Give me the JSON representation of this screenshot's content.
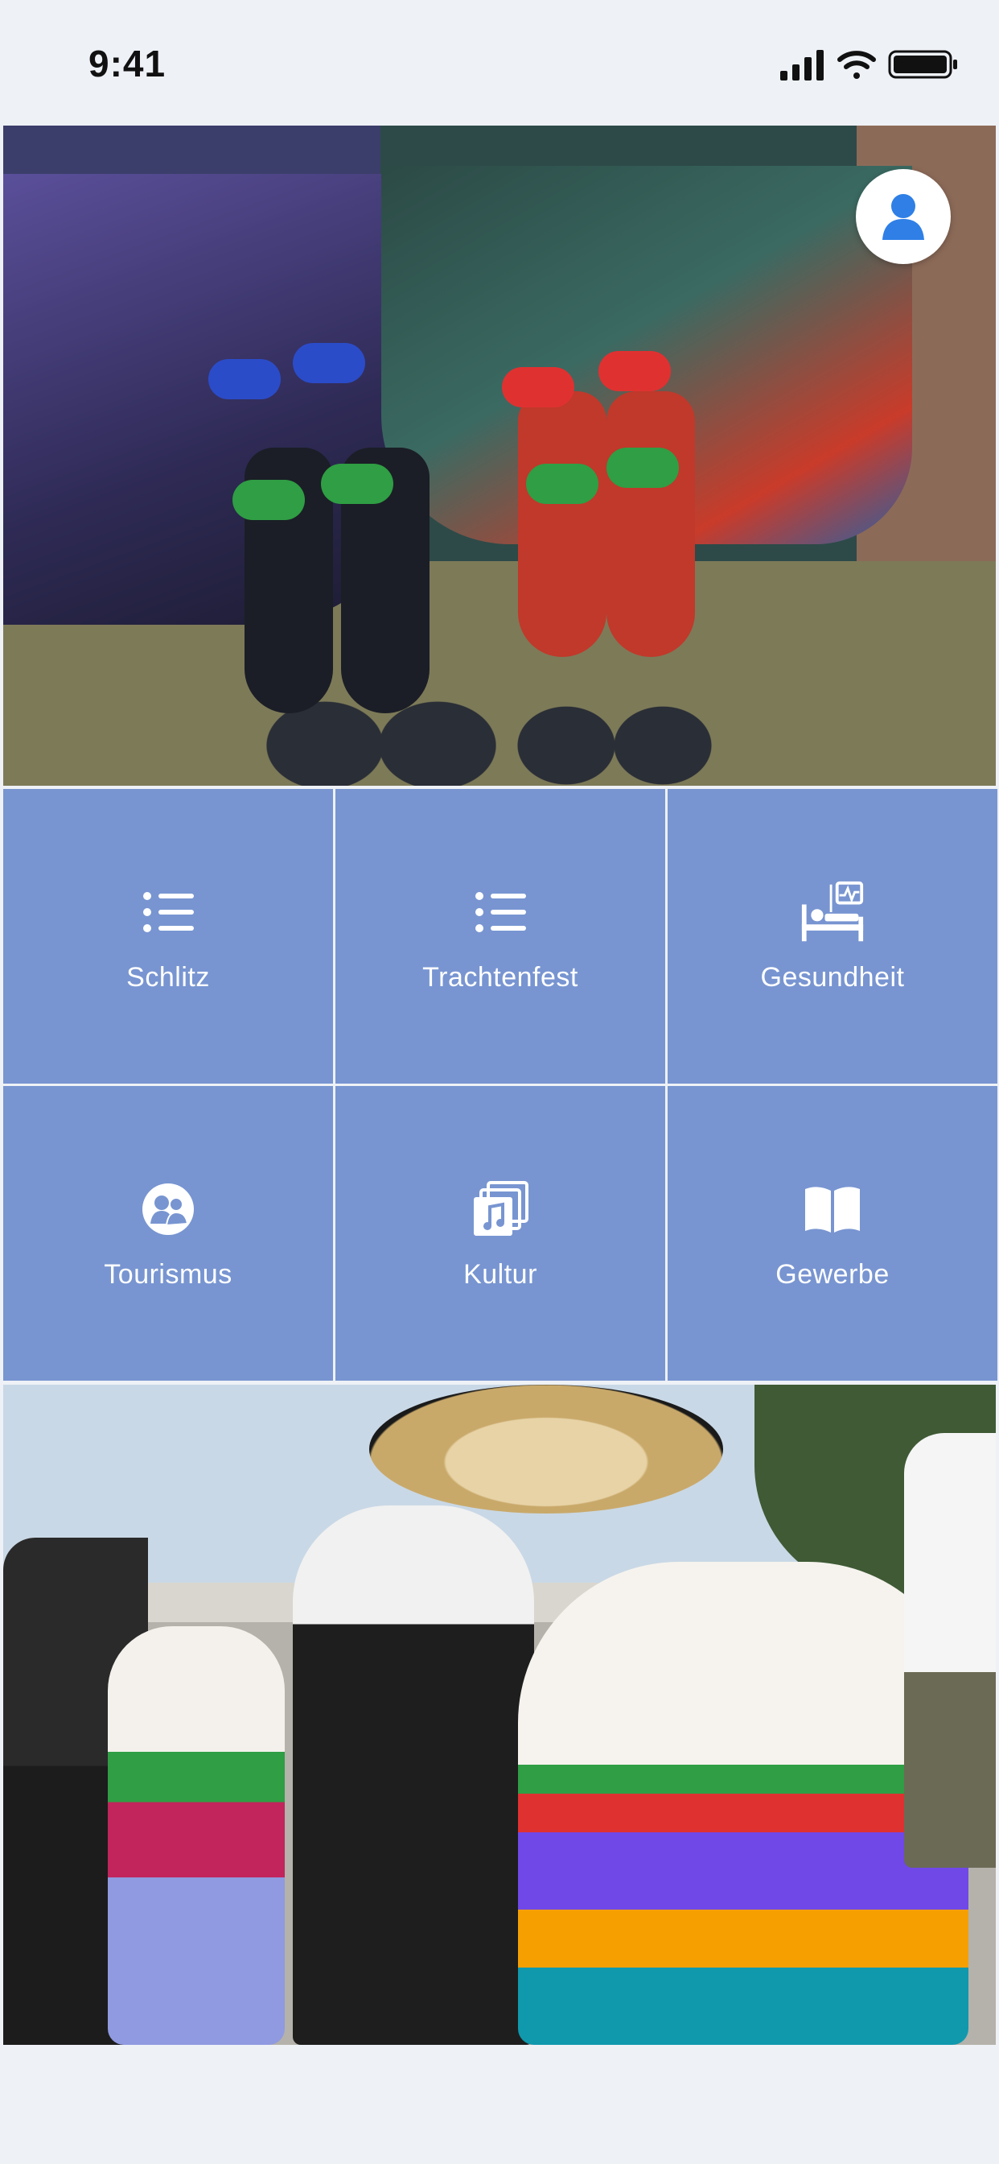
{
  "status_bar": {
    "time": "9:41",
    "icons": [
      "cellular-signal-icon",
      "wifi-icon",
      "battery-icon"
    ]
  },
  "header": {
    "profile_icon": "user-icon"
  },
  "tiles": [
    {
      "label": "Schlitz",
      "icon": "list-icon"
    },
    {
      "label": "Trachtenfest",
      "icon": "list-icon"
    },
    {
      "label": "Gesundheit",
      "icon": "hospital-bed-icon"
    },
    {
      "label": "Tourismus",
      "icon": "people-circle-icon"
    },
    {
      "label": "Kultur",
      "icon": "music-album-icon"
    },
    {
      "label": "Gewerbe",
      "icon": "open-book-icon"
    }
  ],
  "colors": {
    "tile_background": "#7895d1",
    "page_background": "#eef1f6",
    "accent": "#2f7fe6"
  }
}
